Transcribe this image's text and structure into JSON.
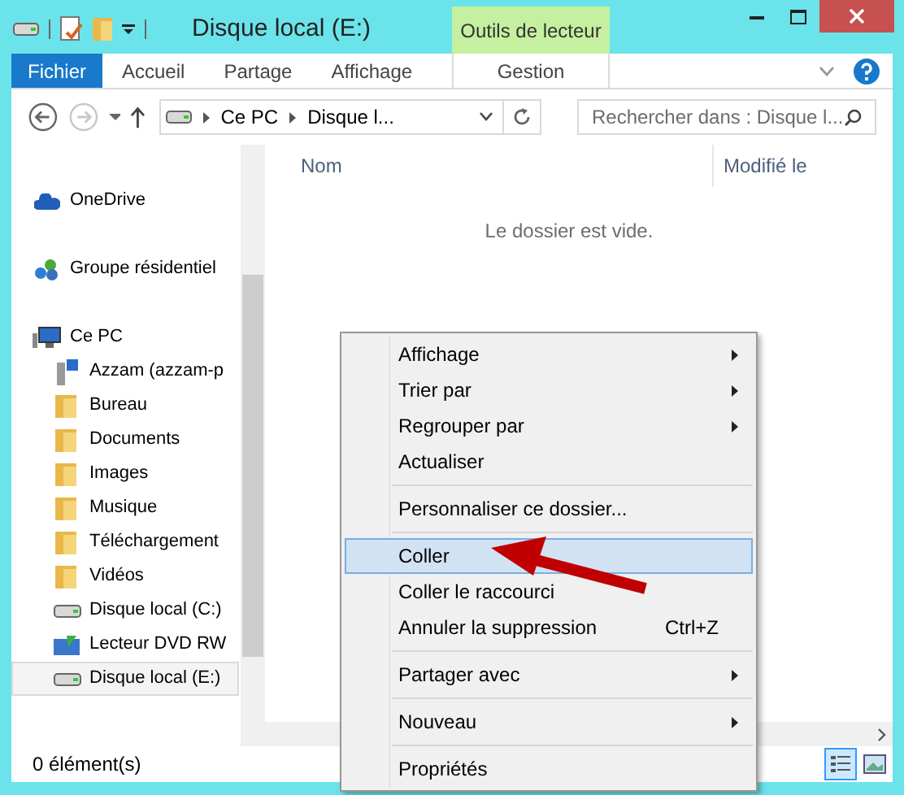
{
  "window": {
    "title": "Disque local (E:)",
    "context_tab": "Outils de lecteur"
  },
  "ribbon_tabs": [
    {
      "label": "Fichier",
      "selected": false,
      "kind": "file"
    },
    {
      "label": "Accueil",
      "selected": false,
      "kind": "tab"
    },
    {
      "label": "Partage",
      "selected": false,
      "kind": "tab"
    },
    {
      "label": "Affichage",
      "selected": false,
      "kind": "tab"
    },
    {
      "label": "Gestion",
      "selected": false,
      "kind": "context"
    }
  ],
  "address": {
    "breadcrumb": [
      "Ce PC",
      "Disque l..."
    ]
  },
  "search": {
    "placeholder": "Rechercher dans : Disque l..."
  },
  "navigation": [
    {
      "label": "OneDrive",
      "kind": "cloud",
      "selected": false
    },
    {
      "label": "Groupe résidentiel",
      "kind": "homegroup",
      "selected": false
    },
    {
      "label": "Ce PC",
      "kind": "pc",
      "selected": false,
      "children": [
        {
          "label": "Azzam (azzam-p",
          "kind": "network",
          "selected": false
        },
        {
          "label": "Bureau",
          "kind": "folder",
          "selected": false
        },
        {
          "label": "Documents",
          "kind": "folder",
          "selected": false
        },
        {
          "label": "Images",
          "kind": "folder",
          "selected": false
        },
        {
          "label": "Musique",
          "kind": "folder",
          "selected": false
        },
        {
          "label": "Téléchargement",
          "kind": "folder",
          "selected": false
        },
        {
          "label": "Vidéos",
          "kind": "folder",
          "selected": false
        },
        {
          "label": "Disque local (C:)",
          "kind": "drive",
          "selected": false
        },
        {
          "label": "Lecteur DVD RW",
          "kind": "dvd",
          "selected": false
        },
        {
          "label": "Disque local (E:)",
          "kind": "drive",
          "selected": true
        }
      ]
    }
  ],
  "columns": [
    "Nom",
    "Modifié le"
  ],
  "empty_message": "Le dossier est vide.",
  "status_bar": "0 élément(s)",
  "context_menu": [
    {
      "kind": "item",
      "label": "Affichage",
      "submenu": true,
      "selected": false
    },
    {
      "kind": "item",
      "label": "Trier par",
      "submenu": true,
      "selected": false
    },
    {
      "kind": "item",
      "label": "Regrouper par",
      "submenu": true,
      "selected": false
    },
    {
      "kind": "item",
      "label": "Actualiser",
      "submenu": false,
      "selected": false
    },
    {
      "kind": "separator"
    },
    {
      "kind": "item",
      "label": "Personnaliser ce dossier...",
      "submenu": false,
      "selected": false
    },
    {
      "kind": "separator"
    },
    {
      "kind": "item",
      "label": "Coller",
      "submenu": false,
      "selected": true
    },
    {
      "kind": "item",
      "label": "Coller le raccourci",
      "submenu": false,
      "selected": false
    },
    {
      "kind": "item",
      "label": "Annuler la suppression",
      "shortcut": "Ctrl+Z",
      "submenu": false,
      "selected": false
    },
    {
      "kind": "separator"
    },
    {
      "kind": "item",
      "label": "Partager avec",
      "submenu": true,
      "selected": false
    },
    {
      "kind": "separator"
    },
    {
      "kind": "item",
      "label": "Nouveau",
      "submenu": true,
      "selected": false
    },
    {
      "kind": "separator"
    },
    {
      "kind": "item",
      "label": "Propriétés",
      "submenu": false,
      "selected": false
    }
  ]
}
